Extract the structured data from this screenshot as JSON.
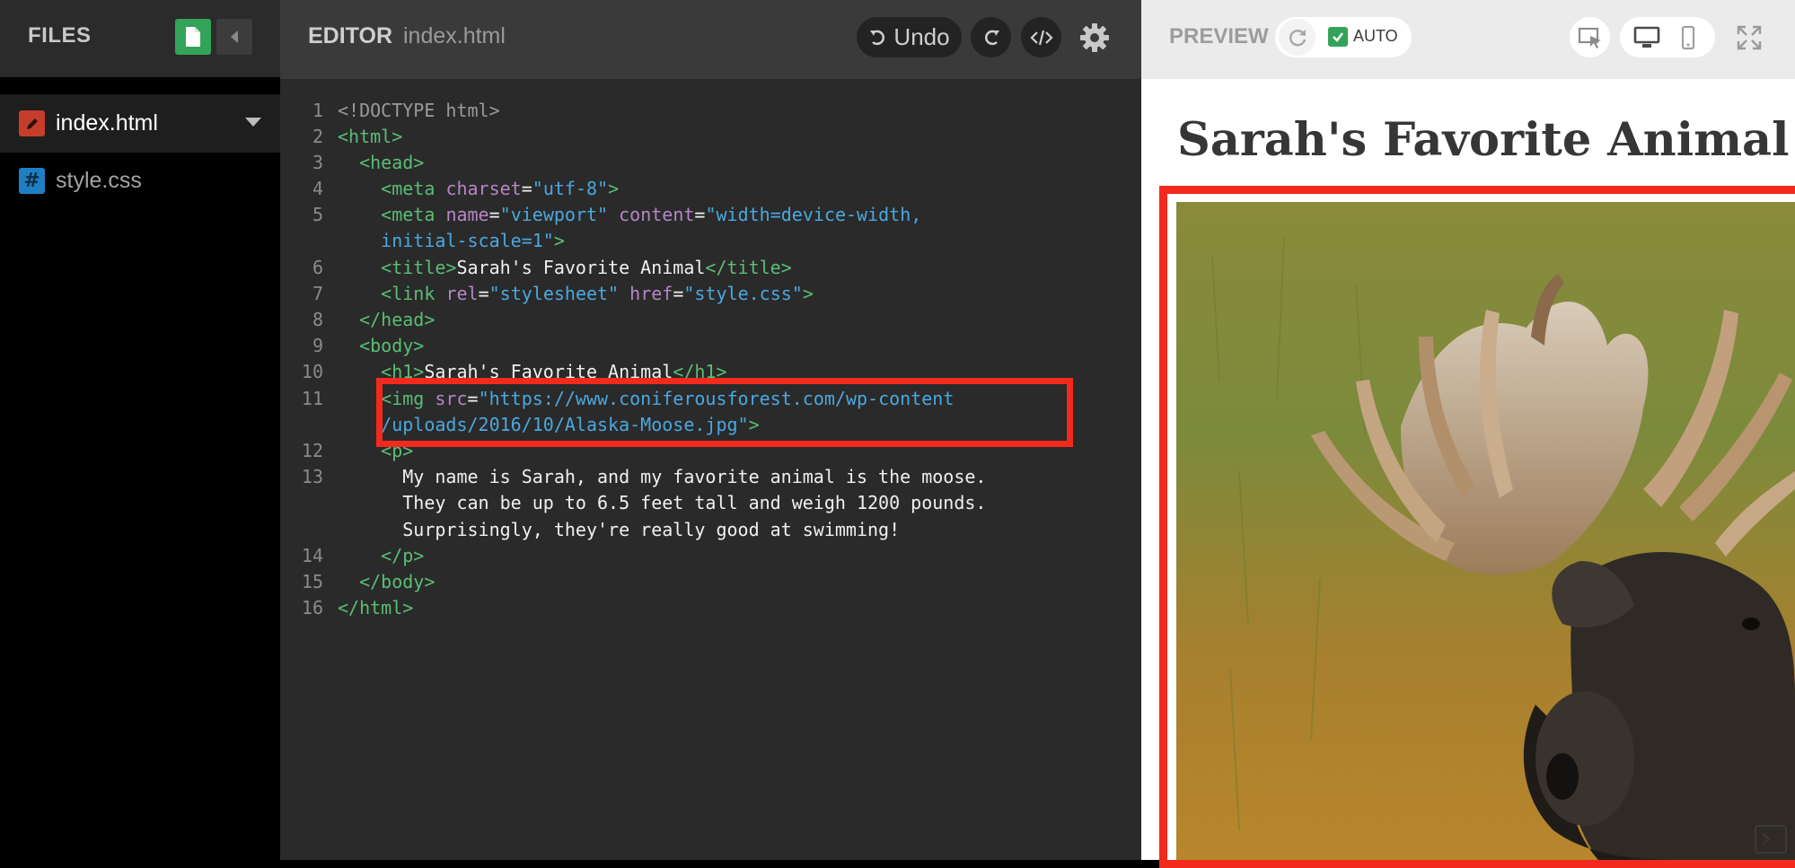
{
  "files_panel": {
    "title": "FILES",
    "files": [
      {
        "name": "index.html",
        "active": true
      },
      {
        "name": "style.css",
        "active": false
      }
    ],
    "css_icon_glyph": "#"
  },
  "editor": {
    "title": "EDITOR",
    "filename": "index.html",
    "undo_label": "Undo",
    "line_numbers": [
      "1",
      "2",
      "3",
      "4",
      "5",
      "6",
      "7",
      "8",
      "9",
      "10",
      "11",
      "12",
      "13",
      "14",
      "15",
      "16"
    ],
    "code": {
      "l1": "<!DOCTYPE html>",
      "l2": "<html>",
      "l3": "<head>",
      "l4_tag": "<meta",
      "l4_attr": "charset",
      "l4_val": "\"utf-8\"",
      "l5_tag": "<meta",
      "l5_attr1": "name",
      "l5_val1": "\"viewport\"",
      "l5_attr2": "content",
      "l5_val2a": "\"width=device-width,",
      "l5_val2b": "initial-scale=1\"",
      "l6_open": "<title>",
      "l6_text": "Sarah's Favorite Animal",
      "l6_close": "</title>",
      "l7_tag": "<link",
      "l7_attr1": "rel",
      "l7_val1": "\"stylesheet\"",
      "l7_attr2": "href",
      "l7_val2": "\"style.css\"",
      "l8": "</head>",
      "l9": "<body>",
      "l10_open": "<h1>",
      "l10_text": "Sarah's Favorite Animal",
      "l10_close": "</h1>",
      "l11_tag": "<img",
      "l11_attr": "src",
      "l11_val_a": "\"https://www.coniferousforest.com/wp-content",
      "l11_val_b": "/uploads/2016/10/Alaska-Moose.jpg\"",
      "l12": "<p>",
      "l13_a": "My name is Sarah, and my favorite animal is the moose.",
      "l13_b": "They can be up to 6.5 feet tall and weigh 1200 pounds.",
      "l13_c": "Surprisingly, they're really good at swimming!",
      "l14": "</p>",
      "l15": "</body>",
      "l16": "</html>"
    }
  },
  "preview": {
    "title": "PREVIEW",
    "auto_label": "AUTO",
    "auto_checked": true,
    "heading": "Sarah's Favorite Animal"
  },
  "colors": {
    "highlight": "#f22a1d",
    "tag": "#5bbd75",
    "attribute": "#b785c9",
    "string": "#4aa8e0",
    "accent_green": "#33a35a"
  },
  "icons": [
    "new-file-icon",
    "collapse-icon",
    "pencil-icon",
    "undo-icon",
    "redo-icon",
    "code-icon",
    "gear-icon",
    "refresh-icon",
    "checkbox-icon",
    "inspect-icon",
    "desktop-icon",
    "mobile-icon",
    "fullscreen-icon",
    "console-icon"
  ]
}
